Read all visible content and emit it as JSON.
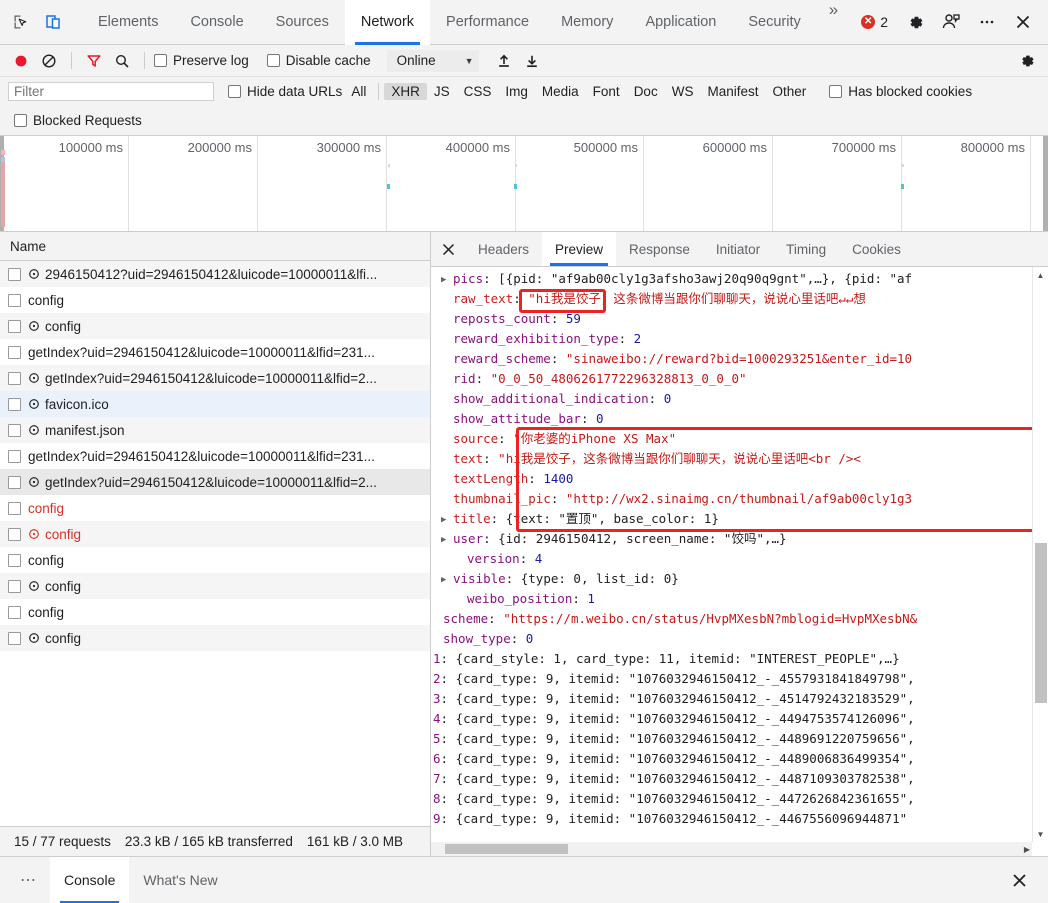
{
  "window": {
    "main_tabs": [
      {
        "label": "Elements",
        "active": false
      },
      {
        "label": "Console",
        "active": false
      },
      {
        "label": "Sources",
        "active": false
      },
      {
        "label": "Network",
        "active": true
      },
      {
        "label": "Performance",
        "active": false
      },
      {
        "label": "Memory",
        "active": false
      },
      {
        "label": "Application",
        "active": false
      },
      {
        "label": "Security",
        "active": false
      }
    ],
    "more_tabs_label": "»",
    "error_count": "2",
    "error_glyph": "✕",
    "accent_color": "#1a73e8",
    "error_color": "#d93025"
  },
  "network_toolbar": {
    "record_title": "Record",
    "clear_title": "Clear",
    "filter_title": "Filter",
    "search_title": "Search",
    "preserve_log_label": "Preserve log",
    "preserve_log_checked": false,
    "disable_cache_label": "Disable cache",
    "disable_cache_checked": false,
    "throttling_value": "Online",
    "throttling_caret": "▼",
    "import_title": "Import HAR",
    "export_title": "Export HAR",
    "settings_title": "Settings"
  },
  "filter_bar": {
    "filter_placeholder": "Filter",
    "filter_value": "",
    "hide_data_urls_label": "Hide data URLs",
    "hide_data_urls_checked": false,
    "types": [
      {
        "label": "All",
        "selected": false
      },
      {
        "label": "XHR",
        "selected": true
      },
      {
        "label": "JS",
        "selected": false
      },
      {
        "label": "CSS",
        "selected": false
      },
      {
        "label": "Img",
        "selected": false
      },
      {
        "label": "Media",
        "selected": false
      },
      {
        "label": "Font",
        "selected": false
      },
      {
        "label": "Doc",
        "selected": false
      },
      {
        "label": "WS",
        "selected": false
      },
      {
        "label": "Manifest",
        "selected": false
      },
      {
        "label": "Other",
        "selected": false
      }
    ],
    "has_blocked_cookies_label": "Has blocked cookies",
    "has_blocked_cookies_checked": false,
    "blocked_requests_label": "Blocked Requests",
    "blocked_requests_checked": false
  },
  "overview": {
    "ticks": [
      "100000 ms",
      "200000 ms",
      "300000 ms",
      "400000 ms",
      "500000 ms",
      "600000 ms",
      "700000 ms",
      "800000 ms"
    ]
  },
  "request_list": {
    "column_header": "Name",
    "rows": [
      {
        "name": "2946150412?uid=2946150412&luicode=10000011&lfi...",
        "has_icon": true,
        "error": false,
        "state": "alt"
      },
      {
        "name": "config",
        "has_icon": false,
        "error": false,
        "state": "none"
      },
      {
        "name": "config",
        "has_icon": true,
        "error": false,
        "state": "alt"
      },
      {
        "name": "getIndex?uid=2946150412&luicode=10000011&lfid=231...",
        "has_icon": false,
        "error": false,
        "state": "none"
      },
      {
        "name": "getIndex?uid=2946150412&luicode=10000011&lfid=2...",
        "has_icon": true,
        "error": false,
        "state": "alt"
      },
      {
        "name": "favicon.ico",
        "has_icon": true,
        "error": false,
        "state": "selblue"
      },
      {
        "name": "manifest.json",
        "has_icon": true,
        "error": false,
        "state": "alt"
      },
      {
        "name": "getIndex?uid=2946150412&luicode=10000011&lfid=231...",
        "has_icon": false,
        "error": false,
        "state": "none"
      },
      {
        "name": "getIndex?uid=2946150412&luicode=10000011&lfid=2...",
        "has_icon": true,
        "error": false,
        "state": "sel"
      },
      {
        "name": "config",
        "has_icon": false,
        "error": true,
        "state": "none"
      },
      {
        "name": "config",
        "has_icon": true,
        "error": true,
        "state": "alt"
      },
      {
        "name": "config",
        "has_icon": false,
        "error": false,
        "state": "none"
      },
      {
        "name": "config",
        "has_icon": true,
        "error": false,
        "state": "alt"
      },
      {
        "name": "config",
        "has_icon": false,
        "error": false,
        "state": "none"
      },
      {
        "name": "config",
        "has_icon": true,
        "error": false,
        "state": "alt"
      }
    ],
    "status": {
      "requests": "15 / 77 requests",
      "transferred": "23.3 kB / 165 kB transferred",
      "resources": "161 kB / 3.0 MB"
    }
  },
  "detail_panel": {
    "close_glyph": "✕",
    "tabs": [
      {
        "label": "Headers",
        "active": false
      },
      {
        "label": "Preview",
        "active": true
      },
      {
        "label": "Response",
        "active": false
      },
      {
        "label": "Initiator",
        "active": false
      },
      {
        "label": "Timing",
        "active": false
      },
      {
        "label": "Cookies",
        "active": false
      }
    ],
    "highlight_color": "#ee2222",
    "preview_lines": [
      {
        "arrow": true,
        "indent": 0,
        "key": "pics",
        "key_color": "purple",
        "value": " [{pid: \"af9ab00cly1g3afsho3awj20q90q9gnt\",…}, {pid: \"af",
        "value_color": "plain"
      },
      {
        "arrow": false,
        "indent": 0,
        "key": "raw_text",
        "key_color": "red",
        "value": " \"hi我是饺子，这条微博当跟你们聊聊天，说说心里话吧↵↵想",
        "value_color": "string"
      },
      {
        "arrow": false,
        "indent": 0,
        "key": "reposts_count",
        "key_color": "purple",
        "value": " 59",
        "value_color": "number"
      },
      {
        "arrow": false,
        "indent": 0,
        "key": "reward_exhibition_type",
        "key_color": "purple",
        "value": " 2",
        "value_color": "number"
      },
      {
        "arrow": false,
        "indent": 0,
        "key": "reward_scheme",
        "key_color": "purple",
        "value": " \"sinaweibo://reward?bid=1000293251&enter_id=10",
        "value_color": "string"
      },
      {
        "arrow": false,
        "indent": 0,
        "key": "rid",
        "key_color": "purple",
        "value": " \"0_0_50_4806261772296328813_0_0_0\"",
        "value_color": "string"
      },
      {
        "arrow": false,
        "indent": 0,
        "key": "show_additional_indication",
        "key_color": "purple",
        "value": " 0",
        "value_color": "number"
      },
      {
        "arrow": false,
        "indent": 0,
        "key": "show_attitude_bar",
        "key_color": "purple",
        "value": " 0",
        "value_color": "number"
      },
      {
        "arrow": false,
        "indent": 0,
        "key": "source",
        "key_color": "red",
        "value": " \"你老婆的iPhone XS Max\"",
        "value_color": "string"
      },
      {
        "arrow": false,
        "indent": 0,
        "key": "text",
        "key_color": "red",
        "value": " \"hi我是饺子，这条微博当跟你们聊聊天，说说心里话吧<br /><",
        "value_color": "string"
      },
      {
        "arrow": false,
        "indent": 0,
        "key": "textLength",
        "key_color": "red",
        "value": " 1400",
        "value_color": "number"
      },
      {
        "arrow": false,
        "indent": 0,
        "key": "thumbnail_pic",
        "key_color": "red",
        "value": " \"http://wx2.sinaimg.cn/thumbnail/af9ab00cly1g3",
        "value_color": "string"
      },
      {
        "arrow": true,
        "indent": 0,
        "key": "title",
        "key_color": "red",
        "value": " {text: \"置顶\", base_color: 1}",
        "value_color": "plain"
      },
      {
        "arrow": true,
        "indent": 0,
        "key": "user",
        "key_color": "purple",
        "value": " {id: 2946150412, screen_name: \"饺吗\",…}",
        "value_color": "plain"
      },
      {
        "arrow": false,
        "indent": 1,
        "key": "version",
        "key_color": "purple",
        "value": " 4",
        "value_color": "number"
      },
      {
        "arrow": true,
        "indent": 0,
        "key": "visible",
        "key_color": "purple",
        "value": " {type: 0, list_id: 0}",
        "value_color": "plain"
      },
      {
        "arrow": false,
        "indent": 1,
        "key": "weibo_position",
        "key_color": "purple",
        "value": " 1",
        "value_color": "number"
      },
      {
        "arrow": false,
        "indent": -1,
        "key": "scheme",
        "key_color": "purple",
        "value": " \"https://m.weibo.cn/status/HvpMXesbN?mblogid=HvpMXesbN&",
        "value_color": "string"
      },
      {
        "arrow": false,
        "indent": -1,
        "key": "show_type",
        "key_color": "purple",
        "value": " 0",
        "value_color": "number"
      },
      {
        "arrow": true,
        "indent": -2,
        "key": "1",
        "key_color": "index",
        "value": " {card_style: 1, card_type: 11, itemid: \"INTEREST_PEOPLE\",…}",
        "value_color": "plain"
      },
      {
        "arrow": true,
        "indent": -2,
        "key": "2",
        "key_color": "index",
        "value": " {card_type: 9, itemid: \"1076032946150412_-_4557931841849798\",",
        "value_color": "plain"
      },
      {
        "arrow": true,
        "indent": -2,
        "key": "3",
        "key_color": "index",
        "value": " {card_type: 9, itemid: \"1076032946150412_-_4514792432183529\",",
        "value_color": "plain"
      },
      {
        "arrow": true,
        "indent": -2,
        "key": "4",
        "key_color": "index",
        "value": " {card_type: 9, itemid: \"1076032946150412_-_4494753574126096\",",
        "value_color": "plain"
      },
      {
        "arrow": true,
        "indent": -2,
        "key": "5",
        "key_color": "index",
        "value": " {card_type: 9, itemid: \"1076032946150412_-_4489691220759656\",",
        "value_color": "plain"
      },
      {
        "arrow": true,
        "indent": -2,
        "key": "6",
        "key_color": "index",
        "value": " {card_type: 9, itemid: \"1076032946150412_-_4489006836499354\",",
        "value_color": "plain"
      },
      {
        "arrow": true,
        "indent": -2,
        "key": "7",
        "key_color": "index",
        "value": " {card_type: 9, itemid: \"1076032946150412_-_4487109303782538\",",
        "value_color": "plain"
      },
      {
        "arrow": true,
        "indent": -2,
        "key": "8",
        "key_color": "index",
        "value": " {card_type: 9, itemid: \"1076032946150412_-_4472626842361655\",",
        "value_color": "plain"
      },
      {
        "arrow": true,
        "indent": -2,
        "key": "9",
        "key_color": "index",
        "value": " {card_type: 9, itemid: \"1076032946150412_-_4467556096944871\"",
        "value_color": "plain"
      }
    ]
  },
  "drawer": {
    "menu_glyph": "⋯",
    "tabs": [
      {
        "label": "Console",
        "active": true
      },
      {
        "label": "What's New",
        "active": false
      }
    ],
    "close_glyph": "✕"
  }
}
